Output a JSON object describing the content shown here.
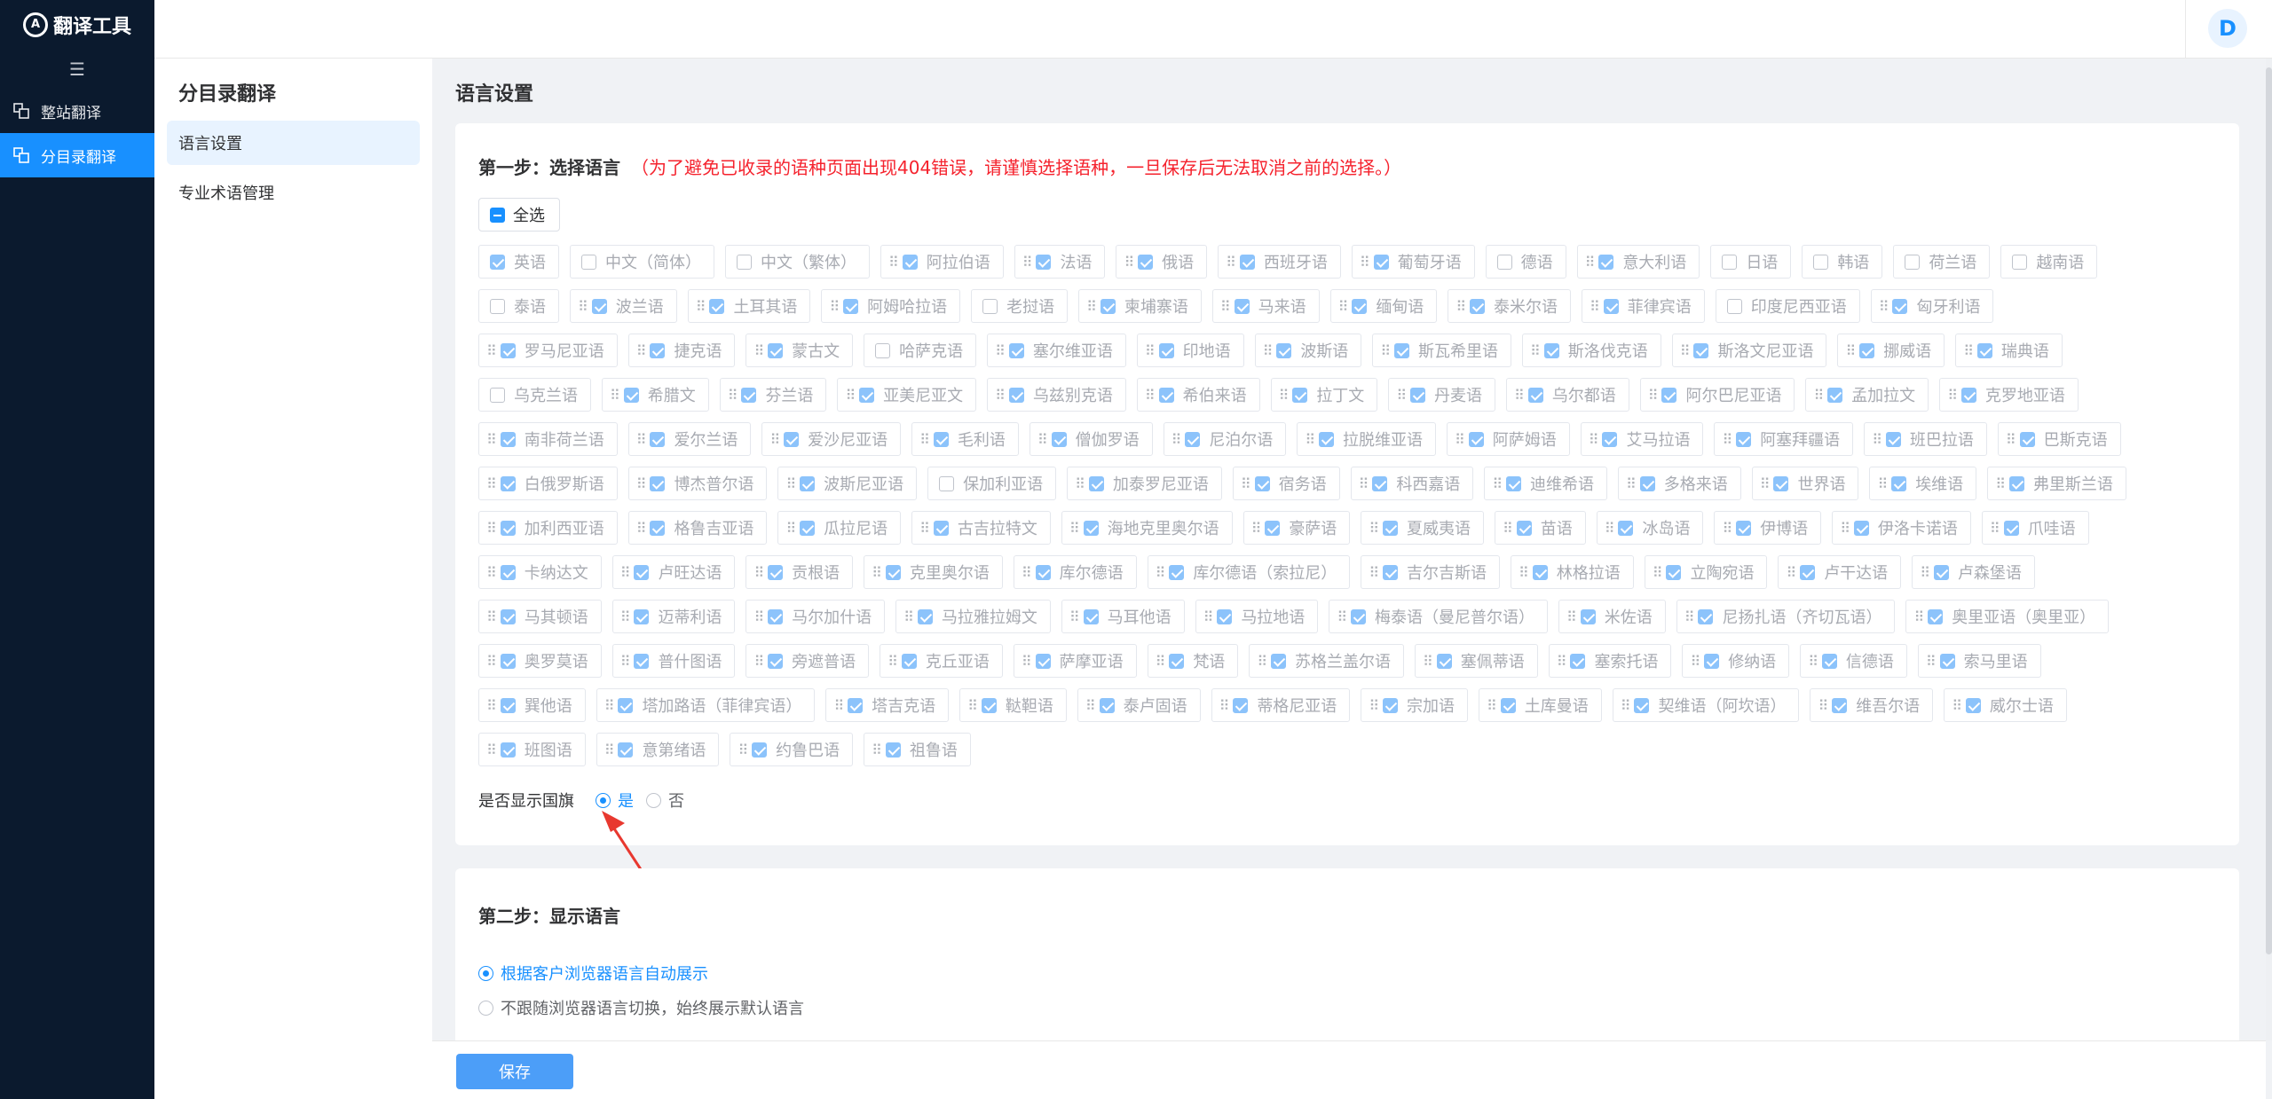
{
  "app": {
    "title": "翻译工具",
    "logo_letter": "A"
  },
  "sidebar": {
    "items": [
      {
        "label": "整站翻译",
        "icon": "translate-icon",
        "active": false
      },
      {
        "label": "分目录翻译",
        "icon": "folder-translate-icon",
        "active": true
      }
    ]
  },
  "topbar": {
    "avatar": "D"
  },
  "subnav": {
    "title": "分目录翻译",
    "items": [
      {
        "label": "语言设置",
        "active": true
      },
      {
        "label": "专业术语管理",
        "active": false
      }
    ]
  },
  "main": {
    "title": "语言设置"
  },
  "step1": {
    "title": "第一步：选择语言",
    "warning": "（为了避免已收录的语种页面出现404错误，请谨慎选择语种，一旦保存后无法取消之前的选择。）",
    "select_all": "全选",
    "languages": [
      [
        [
          "英语",
          1,
          0
        ],
        [
          "中文（简体）",
          0,
          0
        ],
        [
          "中文（繁体）",
          0,
          0
        ],
        [
          "阿拉伯语",
          1,
          1
        ],
        [
          "法语",
          1,
          1
        ],
        [
          "俄语",
          1,
          1
        ],
        [
          "西班牙语",
          1,
          1
        ],
        [
          "葡萄牙语",
          1,
          1
        ],
        [
          "德语",
          0,
          0
        ],
        [
          "意大利语",
          1,
          1
        ],
        [
          "日语",
          0,
          0
        ],
        [
          "韩语",
          0,
          0
        ],
        [
          "荷兰语",
          0,
          0
        ],
        [
          "越南语",
          0,
          0
        ]
      ],
      [
        [
          "泰语",
          0,
          0
        ],
        [
          "波兰语",
          1,
          1
        ],
        [
          "土耳其语",
          1,
          1
        ],
        [
          "阿姆哈拉语",
          1,
          1
        ],
        [
          "老挝语",
          0,
          0
        ],
        [
          "柬埔寨语",
          1,
          1
        ],
        [
          "马来语",
          1,
          1
        ],
        [
          "缅甸语",
          1,
          1
        ],
        [
          "泰米尔语",
          1,
          1
        ],
        [
          "菲律宾语",
          1,
          1
        ],
        [
          "印度尼西亚语",
          0,
          0
        ],
        [
          "匈牙利语",
          1,
          1
        ]
      ],
      [
        [
          "罗马尼亚语",
          1,
          1
        ],
        [
          "捷克语",
          1,
          1
        ],
        [
          "蒙古文",
          1,
          1
        ],
        [
          "哈萨克语",
          0,
          0
        ],
        [
          "塞尔维亚语",
          1,
          1
        ],
        [
          "印地语",
          1,
          1
        ],
        [
          "波斯语",
          1,
          1
        ],
        [
          "斯瓦希里语",
          1,
          1
        ],
        [
          "斯洛伐克语",
          1,
          1
        ],
        [
          "斯洛文尼亚语",
          1,
          1
        ],
        [
          "挪威语",
          1,
          1
        ],
        [
          "瑞典语",
          1,
          1
        ]
      ],
      [
        [
          "乌克兰语",
          0,
          0
        ],
        [
          "希腊文",
          1,
          1
        ],
        [
          "芬兰语",
          1,
          1
        ],
        [
          "亚美尼亚文",
          1,
          1
        ],
        [
          "乌兹别克语",
          1,
          1
        ],
        [
          "希伯来语",
          1,
          1
        ],
        [
          "拉丁文",
          1,
          1
        ],
        [
          "丹麦语",
          1,
          1
        ],
        [
          "乌尔都语",
          1,
          1
        ],
        [
          "阿尔巴尼亚语",
          1,
          1
        ],
        [
          "孟加拉文",
          1,
          1
        ],
        [
          "克罗地亚语",
          1,
          1
        ]
      ],
      [
        [
          "南非荷兰语",
          1,
          1
        ],
        [
          "爱尔兰语",
          1,
          1
        ],
        [
          "爱沙尼亚语",
          1,
          1
        ],
        [
          "毛利语",
          1,
          1
        ],
        [
          "僧伽罗语",
          1,
          1
        ],
        [
          "尼泊尔语",
          1,
          1
        ],
        [
          "拉脱维亚语",
          1,
          1
        ],
        [
          "阿萨姆语",
          1,
          1
        ],
        [
          "艾马拉语",
          1,
          1
        ],
        [
          "阿塞拜疆语",
          1,
          1
        ],
        [
          "班巴拉语",
          1,
          1
        ],
        [
          "巴斯克语",
          1,
          1
        ]
      ],
      [
        [
          "白俄罗斯语",
          1,
          1
        ],
        [
          "博杰普尔语",
          1,
          1
        ],
        [
          "波斯尼亚语",
          1,
          1
        ],
        [
          "保加利亚语",
          0,
          0
        ],
        [
          "加泰罗尼亚语",
          1,
          1
        ],
        [
          "宿务语",
          1,
          1
        ],
        [
          "科西嘉语",
          1,
          1
        ],
        [
          "迪维希语",
          1,
          1
        ],
        [
          "多格来语",
          1,
          1
        ],
        [
          "世界语",
          1,
          1
        ],
        [
          "埃维语",
          1,
          1
        ],
        [
          "弗里斯兰语",
          1,
          1
        ]
      ],
      [
        [
          "加利西亚语",
          1,
          1
        ],
        [
          "格鲁吉亚语",
          1,
          1
        ],
        [
          "瓜拉尼语",
          1,
          1
        ],
        [
          "古吉拉特文",
          1,
          1
        ],
        [
          "海地克里奥尔语",
          1,
          1
        ],
        [
          "豪萨语",
          1,
          1
        ],
        [
          "夏威夷语",
          1,
          1
        ],
        [
          "苗语",
          1,
          1
        ],
        [
          "冰岛语",
          1,
          1
        ],
        [
          "伊博语",
          1,
          1
        ],
        [
          "伊洛卡诺语",
          1,
          1
        ],
        [
          "爪哇语",
          1,
          1
        ]
      ],
      [
        [
          "卡纳达文",
          1,
          1
        ],
        [
          "卢旺达语",
          1,
          1
        ],
        [
          "贡根语",
          1,
          1
        ],
        [
          "克里奥尔语",
          1,
          1
        ],
        [
          "库尔德语",
          1,
          1
        ],
        [
          "库尔德语（索拉尼）",
          1,
          1
        ],
        [
          "吉尔吉斯语",
          1,
          1
        ],
        [
          "林格拉语",
          1,
          1
        ],
        [
          "立陶宛语",
          1,
          1
        ],
        [
          "卢干达语",
          1,
          1
        ],
        [
          "卢森堡语",
          1,
          1
        ]
      ],
      [
        [
          "马其顿语",
          1,
          1
        ],
        [
          "迈蒂利语",
          1,
          1
        ],
        [
          "马尔加什语",
          1,
          1
        ],
        [
          "马拉雅拉姆文",
          1,
          1
        ],
        [
          "马耳他语",
          1,
          1
        ],
        [
          "马拉地语",
          1,
          1
        ],
        [
          "梅泰语（曼尼普尔语）",
          1,
          1
        ],
        [
          "米佐语",
          1,
          1
        ],
        [
          "尼扬扎语（齐切瓦语）",
          1,
          1
        ],
        [
          "奥里亚语（奥里亚）",
          1,
          1
        ]
      ],
      [
        [
          "奥罗莫语",
          1,
          1
        ],
        [
          "普什图语",
          1,
          1
        ],
        [
          "旁遮普语",
          1,
          1
        ],
        [
          "克丘亚语",
          1,
          1
        ],
        [
          "萨摩亚语",
          1,
          1
        ],
        [
          "梵语",
          1,
          1
        ],
        [
          "苏格兰盖尔语",
          1,
          1
        ],
        [
          "塞佩蒂语",
          1,
          1
        ],
        [
          "塞索托语",
          1,
          1
        ],
        [
          "修纳语",
          1,
          1
        ],
        [
          "信德语",
          1,
          1
        ],
        [
          "索马里语",
          1,
          1
        ]
      ],
      [
        [
          "巽他语",
          1,
          1
        ],
        [
          "塔加路语（菲律宾语）",
          1,
          1
        ],
        [
          "塔吉克语",
          1,
          1
        ],
        [
          "鞑靼语",
          1,
          1
        ],
        [
          "泰卢固语",
          1,
          1
        ],
        [
          "蒂格尼亚语",
          1,
          1
        ],
        [
          "宗加语",
          1,
          1
        ],
        [
          "土库曼语",
          1,
          1
        ],
        [
          "契维语（阿坎语）",
          1,
          1
        ],
        [
          "维吾尔语",
          1,
          1
        ],
        [
          "威尔士语",
          1,
          1
        ]
      ],
      [
        [
          "班图语",
          1,
          1
        ],
        [
          "意第绪语",
          1,
          1
        ],
        [
          "约鲁巴语",
          1,
          1
        ],
        [
          "祖鲁语",
          1,
          1
        ]
      ]
    ],
    "flag_label": "是否显示国旗",
    "flag_yes": "是",
    "flag_no": "否"
  },
  "step2": {
    "title": "第二步：显示语言",
    "option_auto": "根据客户浏览器语言自动展示",
    "option_default": "不跟随浏览器语言切换，始终展示默认语言"
  },
  "footer": {
    "save": "保存"
  },
  "colors": {
    "accent": "#1890ff",
    "sidebar_bg": "#0b1a2e",
    "warning": "#f5222d",
    "arrow": "#e8382f"
  }
}
